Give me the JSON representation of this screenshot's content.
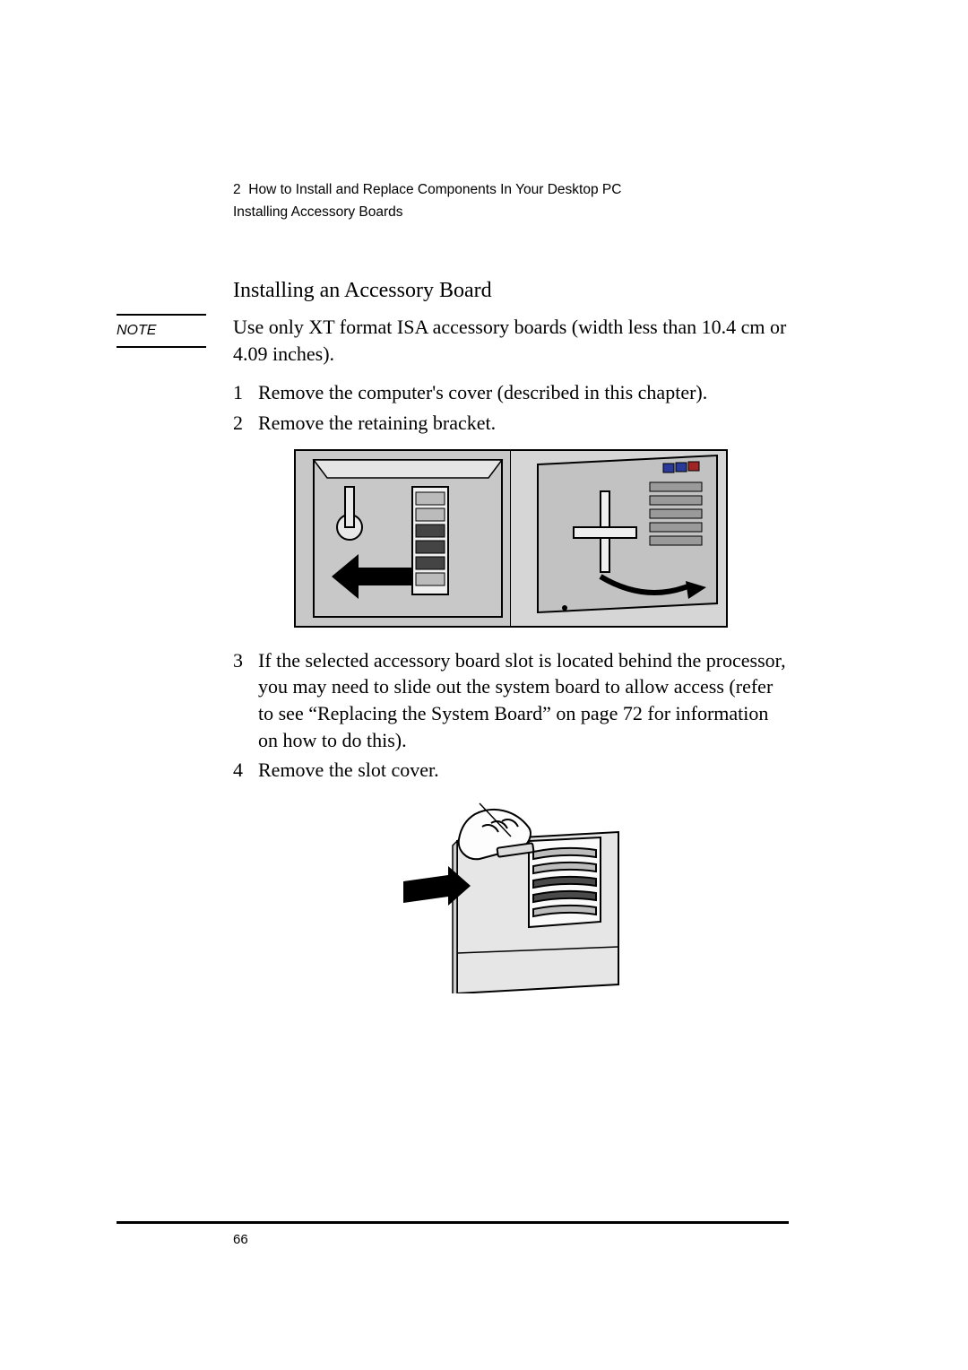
{
  "header": {
    "chapter_number": "2",
    "chapter_title": "How to Install and Replace Components In Your Desktop PC",
    "section_breadcrumb": "Installing Accessory Boards"
  },
  "section_heading": "Installing an Accessory Board",
  "note": {
    "label": "NOTE",
    "text": "Use only XT format ISA accessory boards (width less than 10.4 cm or 4.09 inches)."
  },
  "steps_a": [
    {
      "n": "1",
      "t": "Remove the computer's cover (described in this chapter)."
    },
    {
      "n": "2",
      "t": "Remove the retaining bracket."
    }
  ],
  "steps_b": [
    {
      "n": "3",
      "t": "If the selected accessory board slot is located behind the processor, you may need to slide out the system board to allow access (refer to see “Replacing the System Board” on page 72 for information on how to do this)."
    },
    {
      "n": "4",
      "t": "Remove the slot cover."
    }
  ],
  "figure_alts": {
    "fig1": "Diagram: removing the retaining bracket from the desktop chassis.",
    "fig2": "Diagram: hand removing the slot cover from expansion slots."
  },
  "page_number": "66"
}
